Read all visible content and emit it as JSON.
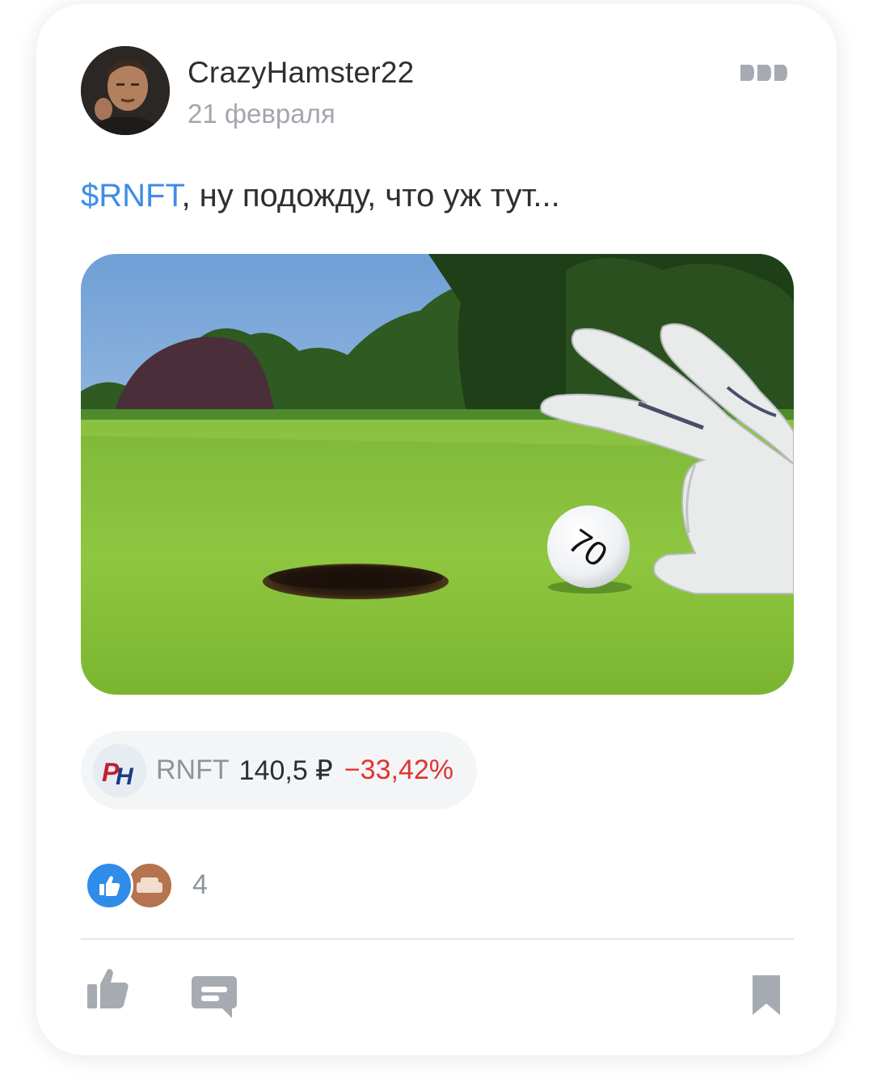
{
  "post": {
    "author": "CrazyHamster22",
    "date": "21 февраля",
    "ticker_link": "$RNFT",
    "text_rest": ", ну подожду, что уж тут...",
    "image": {
      "ball_number": "70"
    }
  },
  "quote": {
    "logo_text": "РН",
    "ticker": "RNFT",
    "price": "140,5 ₽",
    "change": "−33,42%",
    "change_color": "#e3322e"
  },
  "reactions": {
    "count": "4",
    "icons": [
      "thumbs-up-icon",
      "sofa-icon"
    ]
  },
  "actions": {
    "icons": [
      "like-icon",
      "comment-icon",
      "bookmark-icon"
    ]
  },
  "colors": {
    "accent": "#3e8ce8",
    "negative": "#e3322e"
  }
}
